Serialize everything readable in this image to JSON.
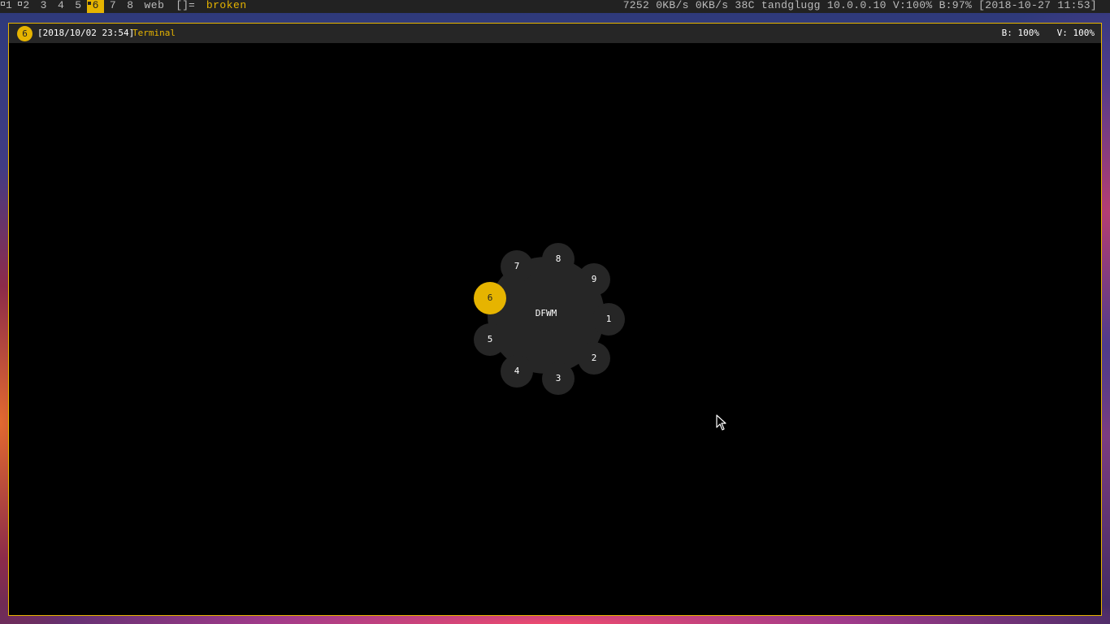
{
  "topbar": {
    "tags": [
      {
        "label": "1",
        "occupied": true,
        "active": false
      },
      {
        "label": "2",
        "occupied": true,
        "active": false
      },
      {
        "label": "3",
        "occupied": false,
        "active": false
      },
      {
        "label": "4",
        "occupied": false,
        "active": false
      },
      {
        "label": "5",
        "occupied": false,
        "active": false
      },
      {
        "label": "6",
        "occupied": true,
        "active": true
      },
      {
        "label": "7",
        "occupied": false,
        "active": false
      },
      {
        "label": "8",
        "occupied": false,
        "active": false
      },
      {
        "label": "web",
        "occupied": false,
        "active": false
      }
    ],
    "layout_symbol": "[]=",
    "focused_title": "broken",
    "status": "7252 0KB/s 0KB/s 38C tandglugg 10.0.0.10 V:100% B:97% [2018-10-27 11:53]"
  },
  "window": {
    "badge": "6",
    "date": "[2018/10/02 23:54]",
    "title": "Terminal",
    "brightness": "B: 100%",
    "volume": "V: 100%"
  },
  "radial_menu": {
    "center_label": "DFWM",
    "nodes": [
      {
        "label": "1",
        "active": false
      },
      {
        "label": "2",
        "active": false
      },
      {
        "label": "3",
        "active": false
      },
      {
        "label": "4",
        "active": false
      },
      {
        "label": "5",
        "active": false
      },
      {
        "label": "6",
        "active": true
      },
      {
        "label": "7",
        "active": false
      },
      {
        "label": "8",
        "active": false
      },
      {
        "label": "9",
        "active": false
      }
    ]
  },
  "colors": {
    "accent": "#e6b400",
    "bar_background": "#222222",
    "panel": "#262626",
    "text_dim": "#bbbbbb",
    "text": "#ffffff"
  },
  "icons": {
    "cursor": "mouse-pointer-icon",
    "occupied_marker": "occupied-tag-square-icon"
  }
}
